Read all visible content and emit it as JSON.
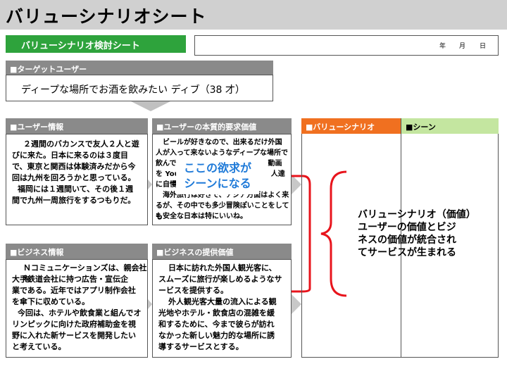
{
  "header": {
    "title": "バリューシナリオシート"
  },
  "sheet_label": "バリューシナリオ検討シート",
  "date": {
    "year": "年",
    "month": "月",
    "day": "日"
  },
  "target": {
    "header": "■ターゲットユーザー",
    "text": "ディープな場所でお酒を飲みたい ディブ（38 才）"
  },
  "user_info": {
    "header": "■ユーザー情報",
    "lines": [
      "２週間のバカンスで友人２人と遊",
      "びに来た。日本に来るのは３度目",
      "で、東京と関西は体験済みだから今",
      "回は九州を回ろうかと思っている。",
      "福岡には１週間いて、その後１週",
      "間で九州一周旅行をするつもりだ。"
    ]
  },
  "user_value": {
    "header": "■ユーザーの本質的要求価値",
    "lines": [
      "ビールが好きなので、出来るだけ外国",
      "人が入って来ないようなディープな場所で",
      "飲んで　　　　　　　　　　　　　動画",
      "を You　　　　　　　　　　　　　人達",
      "に自慢",
      "海外旅行は好きで、アジア方面はよく来",
      "るが、その中でも多少冒険ぽいことをしても",
      "も安全な日本は特にいいね。"
    ]
  },
  "callout": {
    "line1": "ここの欲求が",
    "line2": "シーンになる"
  },
  "biz_info": {
    "header": "■ビジネス情報",
    "lines": [
      "Ｎコミュニケーションズは、親会社を",
      "大手鉄道会社に持つ広告・宣伝企",
      "業である。近年ではアプリ制作会社",
      "を傘下に収めている。",
      "今回は、ホテルや飲食業と組んでオ",
      "リンピックに向けた政府補助金を視",
      "野に入れた新サービスを開発したい",
      "と考えている。"
    ]
  },
  "biz_value": {
    "header": "■ビジネスの提供価値",
    "lines": [
      "日本に訪れた外国人観光客に、",
      "スムーズに旅行が楽しめるようなサ",
      "ービスを提供する。",
      "外人観光客大量の流入による観",
      "光地やホテル・飲食店の混雑を緩",
      "和するために、今まで彼らが訪れ",
      "なかった新しい魅力的な場所に誘",
      "導するサービスとする。"
    ]
  },
  "scenario": {
    "header": "■バリューシナリオ",
    "scene_header": "■シーン"
  },
  "summary": {
    "lines": [
      "バリューシナリオ（価値）",
      "ユーザーの価値とビジ",
      "ネスの価値が統合され",
      "てサービスが生まれる"
    ]
  },
  "colors": {
    "green": "#2ea33c",
    "orange": "#f07020",
    "scene": "#c4e6a0",
    "red": "#e8141c",
    "blue": "#1f7ad8",
    "gray": "#8a8a8a"
  }
}
